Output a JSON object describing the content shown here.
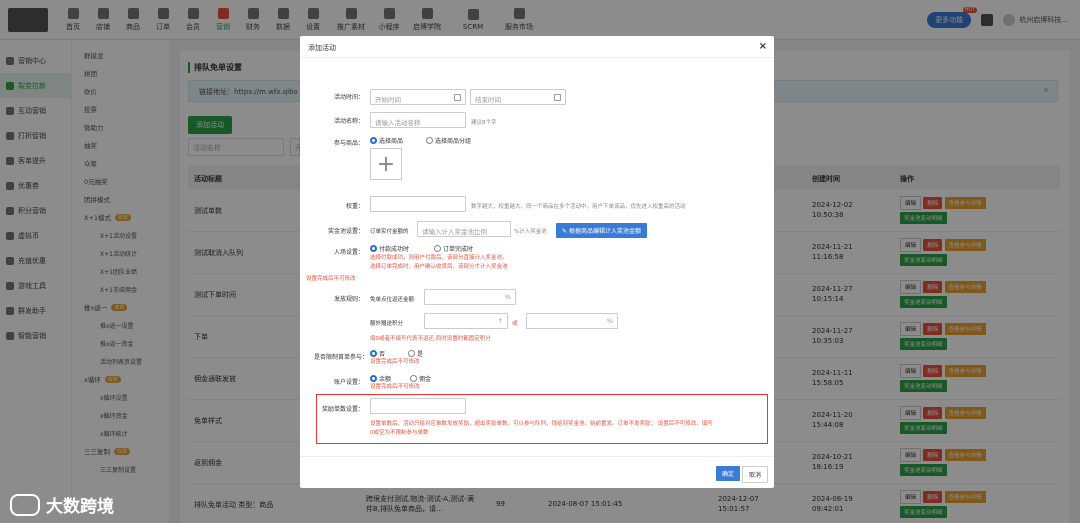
{
  "nav": {
    "items": [
      "首页",
      "店铺",
      "商品",
      "订单",
      "会员",
      "营销",
      "财务",
      "数据",
      "设置",
      "推广素材",
      "小程序",
      "启博学院",
      "SCRM",
      "服务市场"
    ],
    "active": "营销",
    "more": "更多功能",
    "hot": "HOT",
    "company": "杭州启博科技..."
  },
  "sidebar1": [
    "营销中心",
    "裂变拉新",
    "互动营销",
    "打折促销",
    "客单提升",
    "优惠券",
    "积分营销",
    "虚拟币",
    "充值优惠",
    "游戏工具",
    "群发助手",
    "智能营销"
  ],
  "sidebar2": [
    {
      "label": "群接龙",
      "sub": false
    },
    {
      "label": "拼团",
      "sub": false
    },
    {
      "label": "砍价",
      "sub": false
    },
    {
      "label": "投票",
      "sub": false
    },
    {
      "label": "微助力",
      "sub": false
    },
    {
      "label": "抽奖",
      "sub": false
    },
    {
      "label": "众筹",
      "sub": false
    },
    {
      "label": "0元抽奖",
      "sub": false
    },
    {
      "label": "团拼模式",
      "sub": false
    },
    {
      "label": "X+1模式",
      "sub": false,
      "tag": "收费"
    },
    {
      "label": "X+1活动设置",
      "sub": true
    },
    {
      "label": "X+1活动统计",
      "sub": true
    },
    {
      "label": "X+1团队业绩",
      "sub": true
    },
    {
      "label": "X+1冻结佣金",
      "sub": true
    },
    {
      "label": "推x返一",
      "sub": false,
      "tag": "收费"
    },
    {
      "label": "推x返一设置",
      "sub": true
    },
    {
      "label": "推x返一资金",
      "sub": true
    },
    {
      "label": "活动列表页设置",
      "sub": true
    },
    {
      "label": "x循环",
      "sub": false,
      "tag": "收费"
    },
    {
      "label": "x循环设置",
      "sub": true
    },
    {
      "label": "x循环资金",
      "sub": true
    },
    {
      "label": "x循环统计",
      "sub": true
    },
    {
      "label": "三三复制",
      "sub": false,
      "tag": "收费"
    },
    {
      "label": "三三复制设置",
      "sub": true
    }
  ],
  "main": {
    "title": "排队免单设置",
    "link": "链接地址：https://m.wfx.qibo",
    "add_btn": "添加活动",
    "search_placeholder": "活动名称",
    "search2": "开",
    "headers": {
      "title": "活动标题",
      "created": "创建时间",
      "ops": "操作"
    },
    "rows": [
      {
        "title": "测试单数",
        "date": "2024-12-02",
        "time": "10:50:38"
      },
      {
        "title": "测试取消入队列",
        "date": "2024-11-21",
        "time": "11:16:58"
      },
      {
        "title": "测试下单时间",
        "date": "2024-11-27",
        "time": "10:15:14"
      },
      {
        "title": "下单",
        "date": "2024-11-27",
        "time": "10:35:03"
      },
      {
        "title": "佣金通联发放",
        "date": "2024-11-11",
        "time": "15:58:05"
      },
      {
        "title": "免单样式",
        "date": "2024-11-20",
        "time": "15:44:08"
      },
      {
        "title": "返到佣金",
        "date": "2024-10-21",
        "time": "18:16:19"
      },
      {
        "title": "排队免单活动 类型：商品",
        "date": "2024-08-19",
        "time": "09:42:01"
      }
    ],
    "last_row_extra": {
      "desc1": "跨境支付测试,物流-测试-A,测试-满",
      "desc2": "件B,排队免单商品，请...",
      "num": "99",
      "start": "2024-08-07 15:01:45",
      "end": "2024-12-07",
      "end2": "15:01:57"
    },
    "btn_edit": "编辑",
    "btn_del": "删除",
    "btn_view": "查看参与详情",
    "btn_flow": "奖金池变动明细"
  },
  "modal": {
    "title": "添加活动",
    "close": "×",
    "time_label": "活动时间：",
    "start_ph": "开始时间",
    "end_ph": "结束时间",
    "name_label": "活动名称：",
    "name_ph": "请输入活动名称",
    "name_hint": "建议8个字",
    "goods_label": "参与商品：",
    "goods_opt1": "选择商品",
    "goods_opt2": "选择商品分组",
    "plus": "+",
    "weight_label": "权重：",
    "weight_hint": "数字越大，权重越大。同一个商品在多个活动中，用户下单该品，优先进入权重高的活动",
    "pool_label": "奖金池设置：",
    "pool_pre": "订单实付金额的",
    "pool_ph": "请输入计入奖金池比例",
    "pool_suffix": "%计入奖金池",
    "pool_btn": "根据商品编辑计入奖池金额",
    "enter_label": "入场设置：",
    "enter_opt1": "付款成功时",
    "enter_opt2": "订单完成时",
    "enter_red1": "选择付款成功，则用户付款后，该部分直接计入奖金池。",
    "enter_red2": "选择订单完成时，用户确认收货后，该部分才计入奖金池",
    "enter_red3": "设置完成后不可修改",
    "rule_label": "发放规则：",
    "rule_pre": "免单点位返还金额",
    "pct": "%",
    "extra_label": "额外赠送积分",
    "or": "或",
    "rule_red": "填0或者不填写代表不返还,同时设置时都固定积分",
    "limit_label": "是否限制首单参与：",
    "limit_opt1": "否",
    "limit_opt2": "是",
    "limit_red": "设置完成后不可修改",
    "account_label": "账户设置：",
    "account_opt1": "余额",
    "account_opt2": "佣金",
    "account_red": "设置完成后不可修改",
    "reward_label": "奖励单数设置：",
    "reward_red1": "设置单数后，活动只给对应单数发放奖励，超出奖励单数，可以参与队列，钱给到奖金池，给前置发。订单不发奖励； 设置后不可修改，填写",
    "reward_red2": "0或空为不限制参与单数",
    "ok": "确定",
    "cancel": "取消"
  },
  "watermark": "大数跨境"
}
